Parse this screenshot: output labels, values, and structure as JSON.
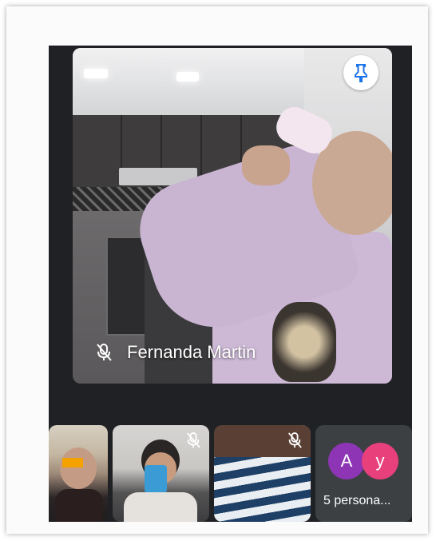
{
  "main_speaker": {
    "name": "Fernanda Martin",
    "mic_state": "muted"
  },
  "actions": {
    "pin_icon": "pin-icon"
  },
  "thumbnails": [
    {
      "mic_state": "unmuted"
    },
    {
      "mic_state": "muted"
    },
    {
      "mic_state": "muted"
    }
  ],
  "others_tile": {
    "avatars": [
      {
        "letter": "A",
        "color": "#8e35b5"
      },
      {
        "letter": "y",
        "color": "#e8407b"
      }
    ],
    "label": "5 persona..."
  },
  "colors": {
    "background": "#202124",
    "pin_icon_color": "#1a73e8"
  }
}
